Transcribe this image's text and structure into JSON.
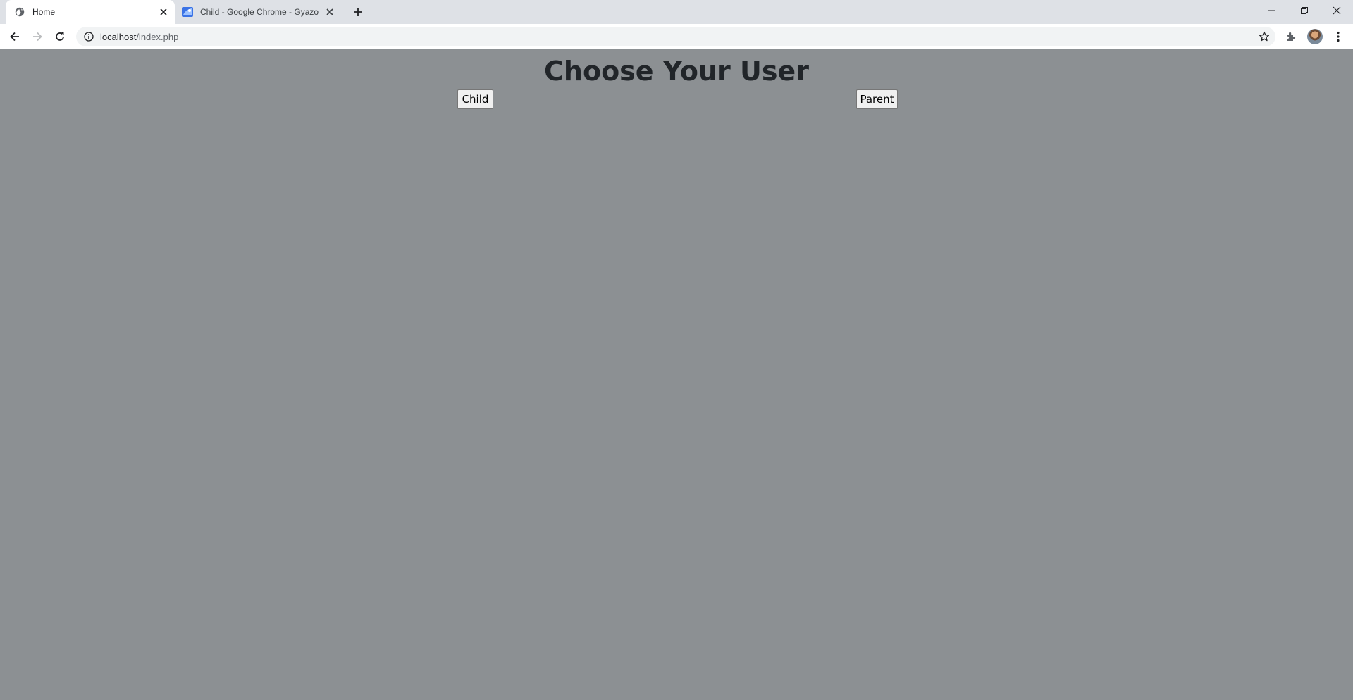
{
  "browser": {
    "tabs": [
      {
        "title": "Home",
        "favicon": "globe-icon",
        "active": true
      },
      {
        "title": "Child - Google Chrome - Gyazo",
        "favicon": "gyazo-icon",
        "active": false
      }
    ],
    "address": {
      "host": "localhost",
      "path": "/index.php"
    }
  },
  "page": {
    "title": "Choose Your User",
    "buttons": {
      "child": "Child",
      "parent": "Parent"
    },
    "colors": {
      "background": "#8c9093",
      "title": "#212529"
    }
  }
}
